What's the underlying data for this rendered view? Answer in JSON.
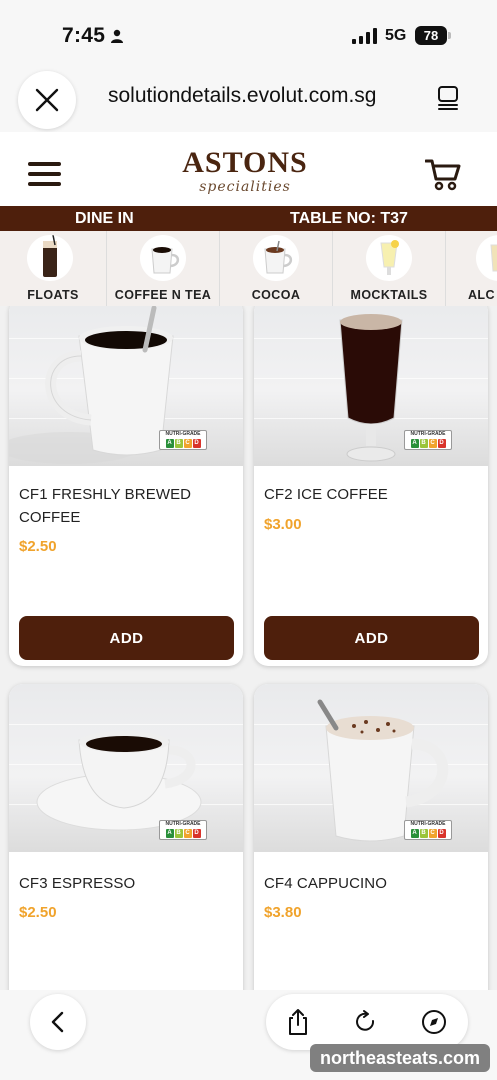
{
  "status_bar": {
    "time": "7:45",
    "network": "5G",
    "battery": "78"
  },
  "browser": {
    "url": "solutiondetails.evolut.com.sg"
  },
  "header": {
    "logo_main": "ASTONS",
    "logo_sub": "specialities"
  },
  "dine_bar": {
    "mode": "DINE IN",
    "table": "TABLE NO: T37"
  },
  "categories": [
    {
      "label": "FLOATS"
    },
    {
      "label": "COFFEE N TEA"
    },
    {
      "label": "COCOA"
    },
    {
      "label": "MOCKTAILS"
    },
    {
      "label": "ALC"
    }
  ],
  "nutri_grade": {
    "title": "NUTRI-GRADE",
    "grades": [
      "A",
      "B",
      "C",
      "D"
    ]
  },
  "products": [
    {
      "name": "CF1 FRESHLY BREWED COFFEE",
      "price": "$2.50",
      "button": "ADD"
    },
    {
      "name": "CF2 ICE COFFEE",
      "price": "$3.00",
      "button": "ADD"
    },
    {
      "name": "CF3 ESPRESSO",
      "price": "$2.50"
    },
    {
      "name": "CF4 CAPPUCINO",
      "price": "$3.80"
    }
  ],
  "watermark": "northeasteats.com",
  "colors": {
    "brand_brown": "#4e1f0c",
    "price_orange": "#f0a32c"
  }
}
